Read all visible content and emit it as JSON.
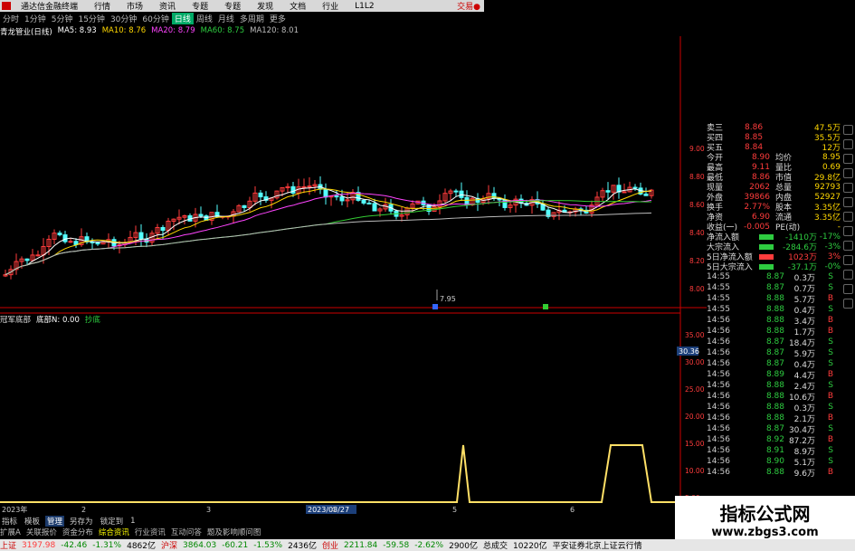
{
  "menubar": {
    "app_title": "通达信金融终端",
    "items": [
      "行情",
      "市场",
      "资讯",
      "专题",
      "专题",
      "发现",
      "文档",
      "行业",
      "L1L2"
    ],
    "right_link": "交易●"
  },
  "periodbar": {
    "items": [
      "分时",
      "1分钟",
      "5分钟",
      "15分钟",
      "30分钟",
      "60分钟",
      "日线",
      "周线",
      "月线",
      "多周期",
      "更多"
    ],
    "active_index": 6
  },
  "ma_header": {
    "stock": "青龙管业(日线)",
    "ma5": "MA5: 8.93",
    "ma10": "MA10: 8.76",
    "ma20": "MA20: 8.79",
    "ma60": "MA60: 8.75",
    "ma120": "MA120: 8.01"
  },
  "main_chart": {
    "price_axis": [
      "9.00",
      "8.80",
      "8.60",
      "8.40",
      "8.20",
      "8.00"
    ],
    "low_label": "7.95",
    "colors": {
      "up": "#ff3c3c",
      "down": "#54ffff",
      "ma5": "#ffffff",
      "ma10": "#ffd700",
      "ma20": "#ff44ff",
      "ma60": "#33cc33",
      "ma120": "#bbbbbb"
    }
  },
  "sub_header": {
    "title": "冠军底部",
    "field1": "底部N: 0.00",
    "field2": "抄底"
  },
  "sub_chart": {
    "axis": [
      "35.00",
      "30.00",
      "25.00",
      "20.00",
      "15.00",
      "10.00",
      "5.00"
    ],
    "highlight": "30.36",
    "date_label": "2023/03/27",
    "year_label": "2023年",
    "x_marks": [
      "2",
      "3",
      "4",
      "5",
      "6"
    ]
  },
  "quote_panel": {
    "book": [
      {
        "label": "卖三",
        "price": "8.86",
        "vol": "47.5万"
      },
      {
        "label": "买四",
        "price": "8.85",
        "vol": "35.5万"
      },
      {
        "label": "买五",
        "price": "8.84",
        "vol": "12万"
      }
    ],
    "stats": [
      {
        "l1": "今开",
        "v1": "8.90",
        "l2": "均价",
        "v2": "8.95"
      },
      {
        "l1": "最高",
        "v1": "9.11",
        "l2": "量比",
        "v2": "0.69"
      },
      {
        "l1": "最低",
        "v1": "8.86",
        "l2": "市值",
        "v2": "29.8亿"
      },
      {
        "l1": "现量",
        "v1": "2062",
        "l2": "总量",
        "v2": "92793"
      },
      {
        "l1": "外盘",
        "v1": "39866",
        "l2": "内盘",
        "v2": "52927"
      },
      {
        "l1": "换手",
        "v1": "2.77%",
        "l2": "股本",
        "v2": "3.35亿"
      },
      {
        "l1": "净资",
        "v1": "6.90",
        "l2": "流通",
        "v2": "3.35亿"
      },
      {
        "l1": "收益(一)",
        "v1": "-0.005",
        "l2": "PE(动)",
        "v2": "-"
      }
    ],
    "flows": [
      {
        "label": "净流入额",
        "value": "-1410万",
        "pct": "-17%"
      },
      {
        "label": "大宗流入",
        "value": "-284.6万",
        "pct": "-3%"
      },
      {
        "label": "5日净流入额",
        "value": "1023万",
        "pct": "3%"
      },
      {
        "label": "5日大宗流入",
        "value": "-37.1万",
        "pct": "-0%"
      }
    ],
    "ticks": [
      {
        "t": "14:55",
        "p": "8.87",
        "v": "0.3万",
        "s": "S"
      },
      {
        "t": "14:55",
        "p": "8.87",
        "v": "0.7万",
        "s": "S"
      },
      {
        "t": "14:55",
        "p": "8.88",
        "v": "5.7万",
        "s": "B"
      },
      {
        "t": "14:55",
        "p": "8.88",
        "v": "0.4万",
        "s": "S"
      },
      {
        "t": "14:56",
        "p": "8.88",
        "v": "3.4万",
        "s": "B"
      },
      {
        "t": "14:56",
        "p": "8.88",
        "v": "1.7万",
        "s": "B"
      },
      {
        "t": "14:56",
        "p": "8.87",
        "v": "18.4万",
        "s": "S"
      },
      {
        "t": "14:56",
        "p": "8.87",
        "v": "5.9万",
        "s": "S"
      },
      {
        "t": "14:56",
        "p": "8.87",
        "v": "0.4万",
        "s": "S"
      },
      {
        "t": "14:56",
        "p": "8.89",
        "v": "4.4万",
        "s": "B"
      },
      {
        "t": "14:56",
        "p": "8.88",
        "v": "2.4万",
        "s": "S"
      },
      {
        "t": "14:56",
        "p": "8.88",
        "v": "10.6万",
        "s": "B"
      },
      {
        "t": "14:56",
        "p": "8.88",
        "v": "0.3万",
        "s": "S"
      },
      {
        "t": "14:56",
        "p": "8.88",
        "v": "2.1万",
        "s": "B"
      },
      {
        "t": "14:56",
        "p": "8.87",
        "v": "30.4万",
        "s": "S"
      },
      {
        "t": "14:56",
        "p": "8.92",
        "v": "87.2万",
        "s": "B"
      },
      {
        "t": "14:56",
        "p": "8.91",
        "v": "8.9万",
        "s": "S"
      },
      {
        "t": "14:56",
        "p": "8.90",
        "v": "5.1万",
        "s": "S"
      },
      {
        "t": "14:56",
        "p": "8.88",
        "v": "9.6万",
        "s": "B"
      }
    ]
  },
  "tabbar": {
    "items": [
      "指标",
      "模板",
      "管理",
      "另存为",
      "锁定到",
      "1"
    ],
    "active_index": 2
  },
  "subtabbar": {
    "items": [
      "扩展A",
      "关联报价",
      "资金分布",
      "综合资讯",
      "行业资讯",
      "互动问答",
      "题及影响顺问图"
    ],
    "active_index": 3
  },
  "statusbar": {
    "items": [
      {
        "label": "上证",
        "value": "3197.98",
        "chg": "-42.46",
        "pct": "-1.31%",
        "amt": "4862亿"
      },
      {
        "label": "沪深",
        "value": "3864.03",
        "chg": "-60.21",
        "pct": "-1.53%",
        "amt": "2436亿"
      },
      {
        "label": "创业",
        "value": "2211.84",
        "chg": "-59.58",
        "pct": "-2.62%",
        "amt": "2900亿"
      }
    ],
    "trade_label": "总成交",
    "trade_value": "10220亿",
    "marquee": "平安证券北京上证云行情"
  },
  "watermark": {
    "title": "指标公式网",
    "url": "www.zbgs3.com"
  }
}
